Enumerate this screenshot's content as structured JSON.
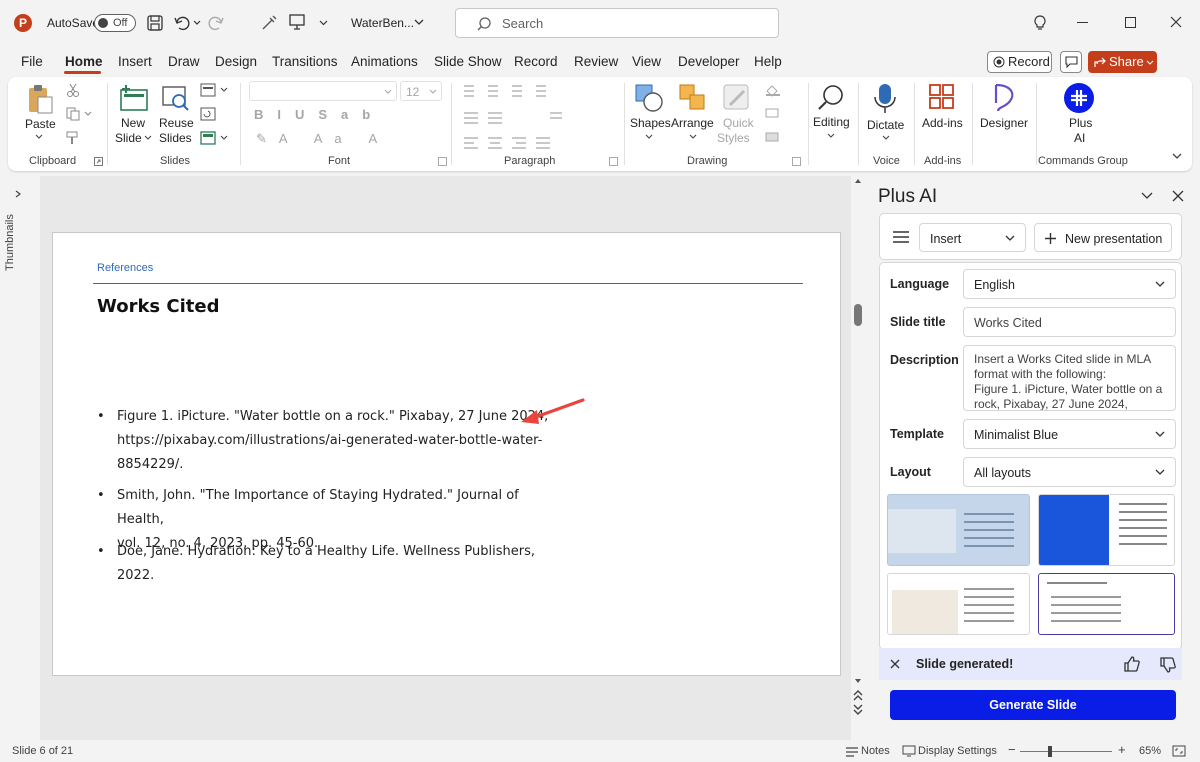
{
  "titlebar": {
    "autosave_label": "AutoSave",
    "autosave_state": "Off",
    "filename": "WaterBen...",
    "search_placeholder": "Search"
  },
  "menu": {
    "items": [
      "File",
      "Home",
      "Insert",
      "Draw",
      "Design",
      "Transitions",
      "Animations",
      "Slide Show",
      "Record",
      "Review",
      "View",
      "Developer",
      "Help"
    ],
    "active": "Home",
    "record_button": "Record",
    "share_button": "Share",
    "accent_color": "#c43e1c"
  },
  "ribbon": {
    "clipboard": {
      "paste": "Paste",
      "group": "Clipboard"
    },
    "slides": {
      "new_slide_1": "New",
      "new_slide_2": "Slide",
      "reuse_1": "Reuse",
      "reuse_2": "Slides",
      "group": "Slides"
    },
    "font": {
      "size": "12",
      "group": "Font"
    },
    "paragraph": {
      "group": "Paragraph"
    },
    "drawing": {
      "shapes": "Shapes",
      "arrange": "Arrange",
      "quick_1": "Quick",
      "quick_2": "Styles",
      "group": "Drawing"
    },
    "editing": {
      "label": "Editing"
    },
    "voice": {
      "dictate": "Dictate",
      "group": "Voice"
    },
    "addins": {
      "label": "Add-ins",
      "group": "Add-ins"
    },
    "designer": {
      "label": "Designer"
    },
    "plusai": {
      "label_1": "Plus",
      "label_2": "AI",
      "group": "Commands Group"
    }
  },
  "thumbnails": {
    "label": "Thumbnails"
  },
  "slide": {
    "section": "References",
    "title": "Works Cited",
    "bullets": [
      [
        "Figure 1. iPicture. \"Water bottle on a rock.\" Pixabay, 27 June 2024,",
        "https://pixabay.com/illustrations/ai-generated-water-bottle-water-",
        "8854229/."
      ],
      [
        "Smith, John. \"The Importance of Staying Hydrated.\" Journal of Health,",
        "vol. 12, no. 4, 2023, pp. 45-60."
      ],
      [
        "Doe, Jane. Hydration: Key to a Healthy Life. Wellness Publishers, 2022."
      ]
    ],
    "arrow_color": "#e8453c"
  },
  "pane": {
    "title": "Plus AI",
    "mode": "Insert",
    "new_presentation": "New presentation",
    "fields": {
      "language_label": "Language",
      "language_value": "English",
      "slide_title_label": "Slide title",
      "slide_title_value": "Works Cited",
      "description_label": "Description",
      "description_lines": [
        "Insert a Works Cited slide in MLA",
        "format with the following:",
        "Figure 1. iPicture, Water bottle on a",
        "rock, Pixabay, 27 June 2024,"
      ],
      "template_label": "Template",
      "template_value": "Minimalist Blue",
      "layout_label": "Layout",
      "layout_value": "All layouts"
    },
    "notice": "Slide generated!",
    "generate_button": "Generate Slide",
    "button_color": "#0a1de6"
  },
  "status": {
    "slide_count": "Slide 6 of 21",
    "notes": "Notes",
    "display_settings": "Display Settings",
    "zoom": "65%"
  }
}
